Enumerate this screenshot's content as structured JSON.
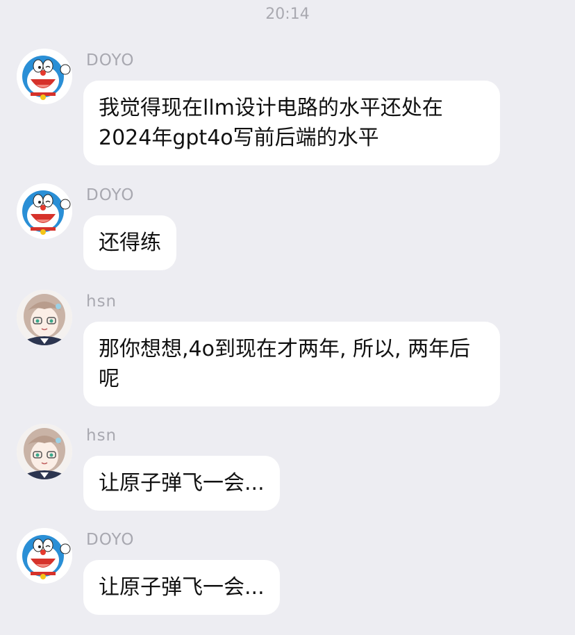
{
  "timestamp": "20:14",
  "messages": [
    {
      "sender": "DOYO",
      "avatar_icon": "doraemon-avatar-icon",
      "text": "我觉得现在llm设计电路的水平还处在2024年gpt4o写前后端的水平"
    },
    {
      "sender": "DOYO",
      "avatar_icon": "doraemon-avatar-icon",
      "text": "还得练"
    },
    {
      "sender": "hsn",
      "avatar_icon": "anime-girl-avatar-icon",
      "text": "那你想想,4o到现在才两年, 所以, 两年后呢"
    },
    {
      "sender": "hsn",
      "avatar_icon": "anime-girl-avatar-icon",
      "text": "让原子弹飞一会..."
    },
    {
      "sender": "DOYO",
      "avatar_icon": "doraemon-avatar-icon",
      "text": "让原子弹飞一会..."
    }
  ],
  "colors": {
    "background": "#ededf2",
    "bubble": "#ffffff",
    "sender_text": "#a8a8b0",
    "timestamp_text": "#a9a9b0"
  }
}
